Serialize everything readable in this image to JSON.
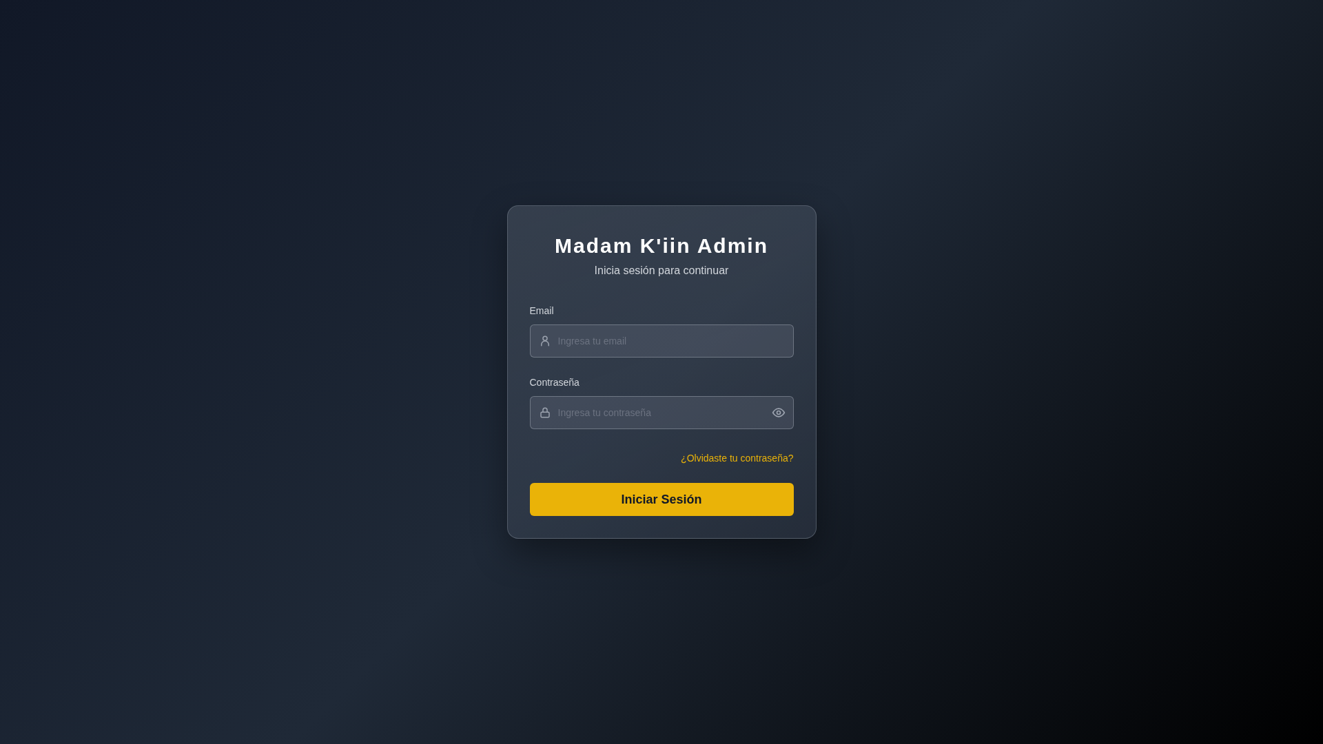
{
  "title": "Madam K'iin Admin",
  "subtitle": "Inicia sesión para continuar",
  "fields": [
    {
      "kind": "email",
      "label": "Email",
      "placeholder": "Ingresa tu email"
    },
    {
      "kind": "password",
      "label": "Contraseña",
      "placeholder": "Ingresa tu contraseña"
    }
  ],
  "forgot_link": "¿Olvidaste tu contraseña?",
  "submit_button": "Iniciar Sesión"
}
